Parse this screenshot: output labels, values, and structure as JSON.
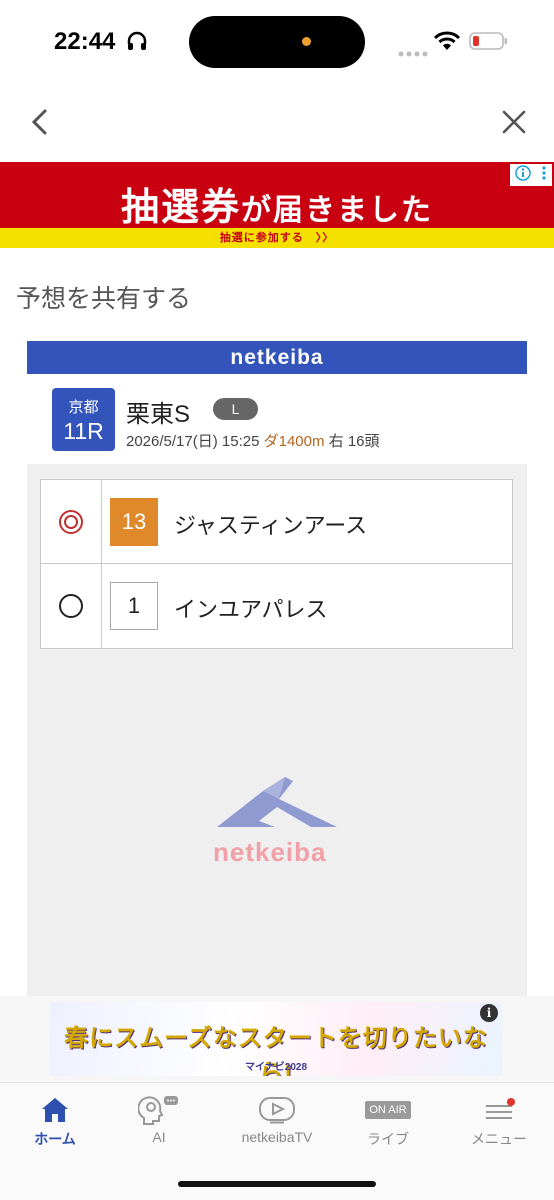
{
  "status_bar": {
    "time": "22:44"
  },
  "nav": {
    "back_icon": "chevron-left-icon",
    "close_icon": "close-icon"
  },
  "ad_top": {
    "headline_big": "抽選券",
    "headline_rest": "が届きました",
    "strip_text": "抽選に参加する　〉〉"
  },
  "page": {
    "section_title": "予想を共有する"
  },
  "card": {
    "brand": "netkeiba",
    "race": {
      "venue": "京都",
      "number": "11R",
      "name": "栗東S",
      "grade": "L",
      "date_time": "2026/5/17(日) 15:25",
      "surface_distance": "ダ1400m",
      "direction_runners": "右 16頭"
    },
    "picks": [
      {
        "mark": "double-circle-icon",
        "number": "13",
        "name": "ジャスティンアース"
      },
      {
        "mark": "circle-icon",
        "number": "1",
        "name": "インユアパレス"
      }
    ],
    "watermark_text": "netkeiba"
  },
  "ad_bottom": {
    "headline": "春にスムーズなスタートを切りたいなら!",
    "sub": "マイナビ2028"
  },
  "tabs": [
    {
      "label": "ホーム",
      "icon": "home-icon",
      "active": true
    },
    {
      "label": "AI",
      "icon": "ai-head-icon",
      "active": false
    },
    {
      "label": "netkeibaTV",
      "icon": "tv-play-icon",
      "active": false
    },
    {
      "label": "ライブ",
      "icon": "on-air-icon",
      "active": false,
      "badge": "ON AIR"
    },
    {
      "label": "メニュー",
      "icon": "menu-icon",
      "active": false
    }
  ],
  "colors": {
    "brand_blue": "#3355bb",
    "ad_red": "#c80010",
    "pick_orange": "#e0892b",
    "honmei_red": "#c03030"
  }
}
